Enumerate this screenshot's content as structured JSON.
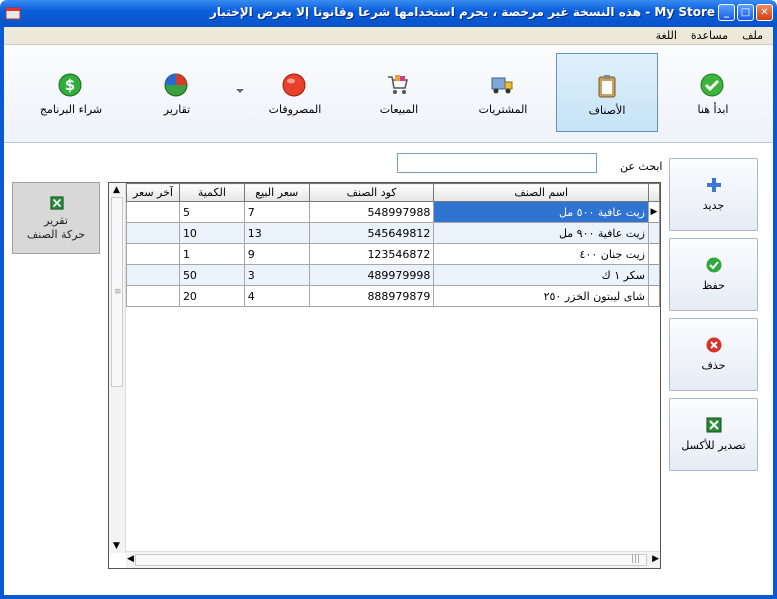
{
  "window": {
    "title": "My Store - هذه النسخة غير مرخصة ، يحرم استخدامها شرعا وقانونا إلا بغرض الإختبار",
    "buttons": {
      "minimize": "_",
      "maximize": "□",
      "close": "✕"
    }
  },
  "menu": [
    "ملف",
    "مساعدة",
    "اللغة"
  ],
  "ribbon": [
    {
      "key": "start",
      "label": "ابدأ هنا",
      "icon": "check-circle-icon",
      "active": false
    },
    {
      "key": "items",
      "label": "الأصناف",
      "icon": "clipboard-icon",
      "active": true
    },
    {
      "key": "purchases",
      "label": "المشتريات",
      "icon": "truck-icon",
      "active": false
    },
    {
      "key": "sales",
      "label": "المبيعات",
      "icon": "shopping-cart-icon",
      "active": false
    },
    {
      "key": "expenses",
      "label": "المصروفات",
      "icon": "red-ball-icon",
      "active": false
    },
    {
      "key": "reports",
      "label": "تقارير",
      "icon": "pie-chart-icon",
      "active": false
    },
    {
      "key": "buy",
      "label": "شراء البرنامج",
      "icon": "dollar-icon",
      "active": false
    }
  ],
  "actions": [
    {
      "key": "new",
      "label": "جديد",
      "icon": "plus-icon"
    },
    {
      "key": "save",
      "label": "حفظ",
      "icon": "check-icon"
    },
    {
      "key": "delete",
      "label": "حذف",
      "icon": "x-circle-icon"
    },
    {
      "key": "export",
      "label": "تصدير للأكسل",
      "icon": "excel-icon"
    }
  ],
  "search": {
    "label": "ابحث عن",
    "value": ""
  },
  "report_button": {
    "label_line1": "تقرير",
    "label_line2": "حركة الصنف",
    "icon": "excel-icon"
  },
  "table": {
    "columns": [
      "آخر سعر",
      "الكمية",
      "سعر البيع",
      "كود الصنف",
      "اسم الصنف"
    ],
    "rows": [
      {
        "last_price": "",
        "qty": "5",
        "price": "7",
        "code": "548997988",
        "name": "زيت عافية ٥٠٠ مل"
      },
      {
        "last_price": "",
        "qty": "10",
        "price": "13",
        "code": "545649812",
        "name": "زيت عافية ٩٠٠ مل"
      },
      {
        "last_price": "",
        "qty": "1",
        "price": "9",
        "code": "123546872",
        "name": "زيت جنان ٤٠٠"
      },
      {
        "last_price": "",
        "qty": "50",
        "price": "3",
        "code": "489979998",
        "name": "سكر ١ ك"
      },
      {
        "last_price": "",
        "qty": "20",
        "price": "4",
        "code": "888979879",
        "name": "شاى ليبتون الخزر ٢٥٠"
      }
    ],
    "selected_row": 0
  }
}
